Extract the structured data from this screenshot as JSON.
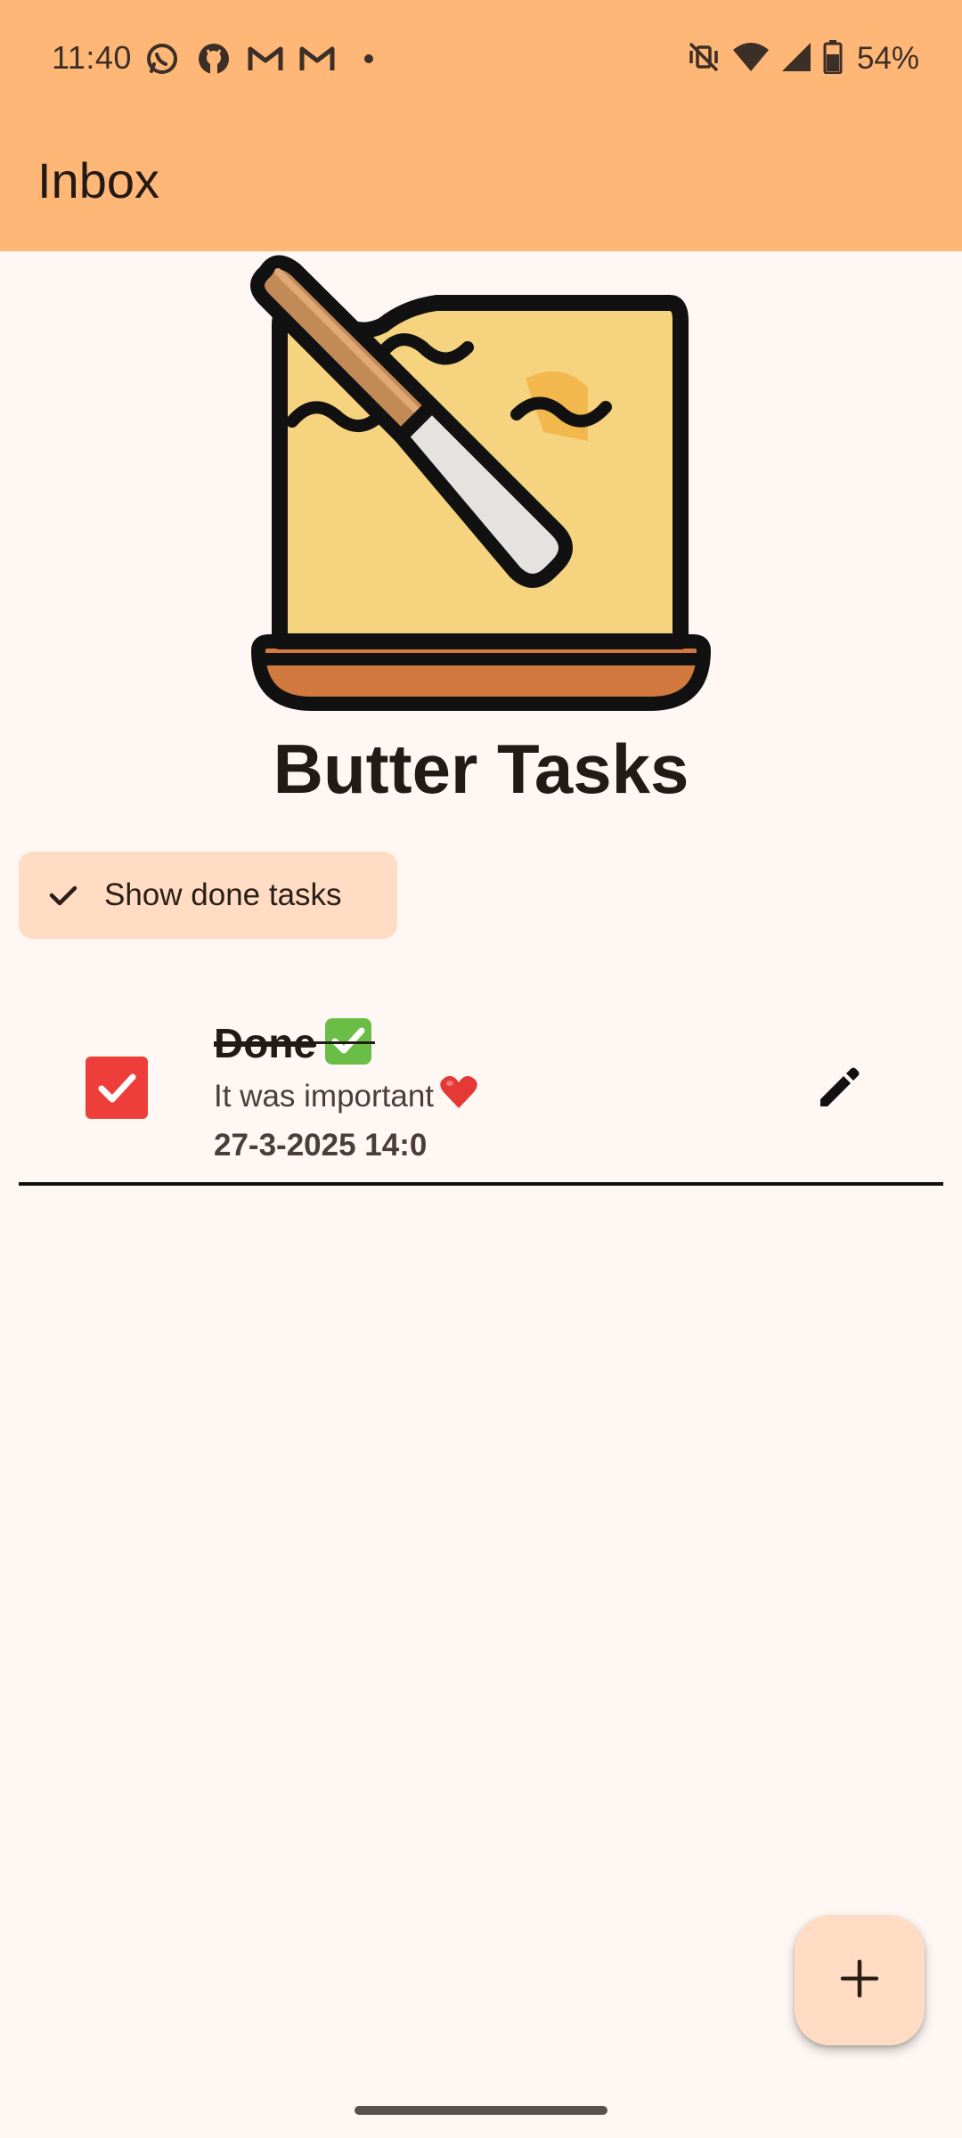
{
  "status_bar": {
    "time": "11:40",
    "left_icons": [
      "whatsapp-icon",
      "github-icon",
      "gmail-icon",
      "gmail-icon",
      "dot-icon"
    ],
    "right_icons": [
      "mute-vibrate-icon",
      "wifi-icon",
      "cell-signal-icon",
      "battery-icon"
    ],
    "battery_percent": "54%"
  },
  "app_bar": {
    "title": "Inbox"
  },
  "hero": {
    "app_name": "Butter Tasks",
    "logo_icon": "butter-knife-logo-icon"
  },
  "filter": {
    "label": "Show done tasks",
    "selected": true,
    "icon": "check-icon"
  },
  "tasks": [
    {
      "title": "Done",
      "title_emoji": "check-mark-button-emoji",
      "description": "It was important",
      "description_emoji": "red-heart-emoji",
      "date": "27-3-2025 14:0",
      "done": true,
      "edit_icon": "pencil-icon"
    }
  ],
  "fab": {
    "icon": "plus-icon"
  },
  "colors": {
    "header": "#FFB777",
    "background": "#FFF7F3",
    "chip": "#FFDCC3",
    "checkbox": "#EE3E3A",
    "fab": "#FFDCC3"
  }
}
